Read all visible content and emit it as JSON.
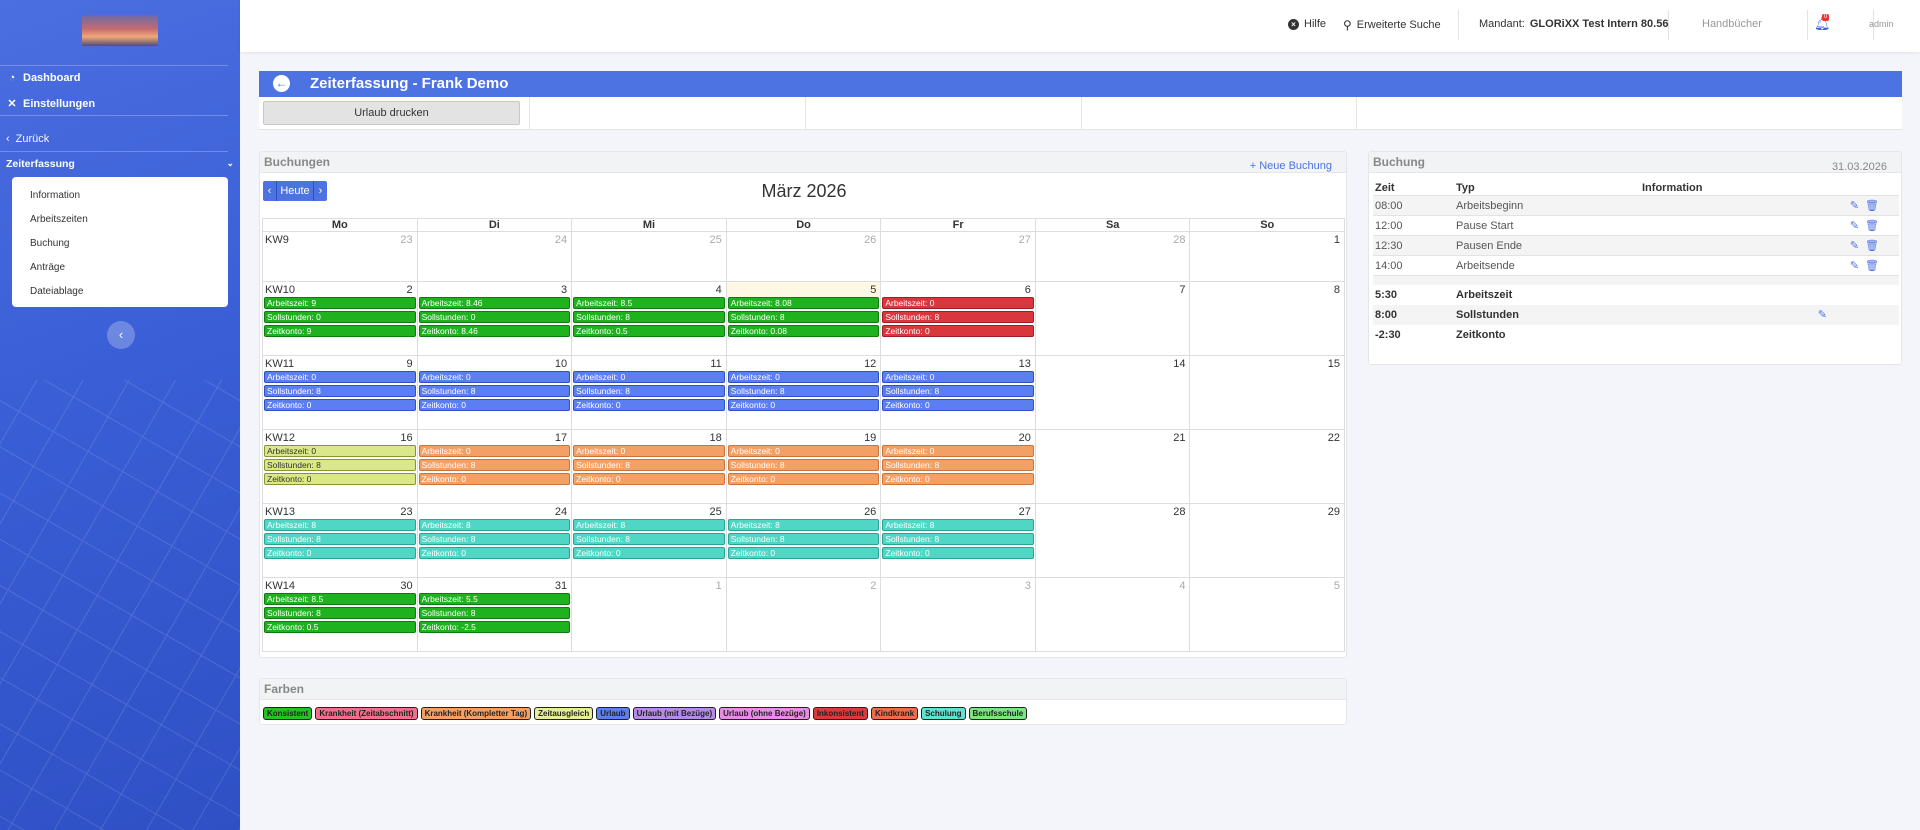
{
  "sidebar": {
    "dashboard": "Dashboard",
    "settings": "Einstellungen",
    "back": "Zurück",
    "section": "Zeiterfassung",
    "items": [
      "Information",
      "Arbeitszeiten",
      "Buchung",
      "Anträge",
      "Dateiablage"
    ]
  },
  "topbar": {
    "help": "Hilfe",
    "search": "Erweiterte Suche",
    "mandant_label": "Mandant:",
    "mandant_value": "GLORiXX Test Intern 80.56",
    "manuals": "Handbücher",
    "badge": "0",
    "user": "admin"
  },
  "header": {
    "title": "Zeiterfassung - Frank Demo",
    "print_button": "Urlaub drucken"
  },
  "calendar": {
    "panel_title": "Buchungen",
    "new_booking": "Neue Buchung",
    "today": "Heute",
    "month": "März 2026",
    "weekdays": [
      "Mo",
      "Di",
      "Mi",
      "Do",
      "Fr",
      "Sa",
      "So"
    ],
    "weeks": [
      {
        "kw": "KW9",
        "days": [
          {
            "n": "23",
            "o": 1
          },
          {
            "n": "24",
            "o": 1
          },
          {
            "n": "25",
            "o": 1
          },
          {
            "n": "26",
            "o": 1
          },
          {
            "n": "27",
            "o": 1
          },
          {
            "n": "28",
            "o": 1
          },
          {
            "n": "1"
          }
        ]
      },
      {
        "kw": "KW10",
        "days": [
          {
            "n": "2",
            "c": "green",
            "e": [
              "Arbeitszeit: 9",
              "Sollstunden: 0",
              "Zeitkonto: 9"
            ]
          },
          {
            "n": "3",
            "c": "green",
            "e": [
              "Arbeitszeit: 8.46",
              "Sollstunden: 0",
              "Zeitkonto: 8.46"
            ]
          },
          {
            "n": "4",
            "c": "green",
            "e": [
              "Arbeitszeit: 8.5",
              "Sollstunden: 8",
              "Zeitkonto: 0.5"
            ]
          },
          {
            "n": "5",
            "c": "green",
            "t": 1,
            "e": [
              "Arbeitszeit: 8.08",
              "Sollstunden: 8",
              "Zeitkonto: 0.08"
            ]
          },
          {
            "n": "6",
            "c": "red",
            "e": [
              "Arbeitszeit: 0",
              "Sollstunden: 8",
              "Zeitkonto: 0"
            ]
          },
          {
            "n": "7"
          },
          {
            "n": "8"
          }
        ]
      },
      {
        "kw": "KW11",
        "days": [
          {
            "n": "9",
            "c": "blue",
            "e": [
              "Arbeitszeit: 0",
              "Sollstunden: 8",
              "Zeitkonto: 0"
            ]
          },
          {
            "n": "10",
            "c": "blue",
            "e": [
              "Arbeitszeit: 0",
              "Sollstunden: 8",
              "Zeitkonto: 0"
            ]
          },
          {
            "n": "11",
            "c": "blue",
            "e": [
              "Arbeitszeit: 0",
              "Sollstunden: 8",
              "Zeitkonto: 0"
            ]
          },
          {
            "n": "12",
            "c": "blue",
            "e": [
              "Arbeitszeit: 0",
              "Sollstunden: 8",
              "Zeitkonto: 0"
            ]
          },
          {
            "n": "13",
            "c": "blue",
            "e": [
              "Arbeitszeit: 0",
              "Sollstunden: 8",
              "Zeitkonto: 0"
            ]
          },
          {
            "n": "14"
          },
          {
            "n": "15"
          }
        ]
      },
      {
        "kw": "KW12",
        "days": [
          {
            "n": "16",
            "c": "yellow",
            "e": [
              "Arbeitszeit: 0",
              "Sollstunden: 8",
              "Zeitkonto: 0"
            ]
          },
          {
            "n": "17",
            "c": "orange",
            "e": [
              "Arbeitszeit: 0",
              "Sollstunden: 8",
              "Zeitkonto: 0"
            ]
          },
          {
            "n": "18",
            "c": "orange",
            "e": [
              "Arbeitszeit: 0",
              "Sollstunden: 8",
              "Zeitkonto: 0"
            ]
          },
          {
            "n": "19",
            "c": "orange",
            "e": [
              "Arbeitszeit: 0",
              "Sollstunden: 8",
              "Zeitkonto: 0"
            ]
          },
          {
            "n": "20",
            "c": "orange",
            "e": [
              "Arbeitszeit: 0",
              "Sollstunden: 8",
              "Zeitkonto: 0"
            ]
          },
          {
            "n": "21"
          },
          {
            "n": "22"
          }
        ]
      },
      {
        "kw": "KW13",
        "days": [
          {
            "n": "23",
            "c": "teal",
            "e": [
              "Arbeitszeit: 8",
              "Sollstunden: 8",
              "Zeitkonto: 0"
            ]
          },
          {
            "n": "24",
            "c": "teal",
            "e": [
              "Arbeitszeit: 8",
              "Sollstunden: 8",
              "Zeitkonto: 0"
            ]
          },
          {
            "n": "25",
            "c": "teal",
            "e": [
              "Arbeitszeit: 8",
              "Sollstunden: 8",
              "Zeitkonto: 0"
            ]
          },
          {
            "n": "26",
            "c": "teal",
            "e": [
              "Arbeitszeit: 8",
              "Sollstunden: 8",
              "Zeitkonto: 0"
            ]
          },
          {
            "n": "27",
            "c": "teal",
            "e": [
              "Arbeitszeit: 8",
              "Sollstunden: 8",
              "Zeitkonto: 0"
            ]
          },
          {
            "n": "28"
          },
          {
            "n": "29"
          }
        ]
      },
      {
        "kw": "KW14",
        "days": [
          {
            "n": "30",
            "c": "green",
            "e": [
              "Arbeitszeit: 8.5",
              "Sollstunden: 8",
              "Zeitkonto: 0.5"
            ]
          },
          {
            "n": "31",
            "c": "green",
            "e": [
              "Arbeitszeit: 5.5",
              "Sollstunden: 8",
              "Zeitkonto: -2.5"
            ]
          },
          {
            "n": "1",
            "o": 1
          },
          {
            "n": "2",
            "o": 1
          },
          {
            "n": "3",
            "o": 1
          },
          {
            "n": "4",
            "o": 1
          },
          {
            "n": "5",
            "o": 1
          }
        ]
      }
    ]
  },
  "colors": {
    "green": {
      "bg": "#1fb21f",
      "border": "#0f7a0f",
      "text": "#ffffff"
    },
    "red": {
      "bg": "#d9363e",
      "border": "#a01e24",
      "text": "#ffffff"
    },
    "blue": {
      "bg": "#5b7ef0",
      "border": "#2f50c5",
      "text": "#ffffff"
    },
    "yellow": {
      "bg": "#dbe88a",
      "border": "#8a9433",
      "text": "#333333"
    },
    "orange": {
      "bg": "#f3a066",
      "border": "#c9743a",
      "text": "#ffffff"
    },
    "teal": {
      "bg": "#4fd6c4",
      "border": "#2aa595",
      "text": "#ffffff"
    }
  },
  "legend": {
    "title": "Farben",
    "items": [
      {
        "label": "Konsistent",
        "color": "#22c322"
      },
      {
        "label": "Krankheit (Zeitabschnitt)",
        "color": "#ef6f8c"
      },
      {
        "label": "Krankheit (Kompletter Tag)",
        "color": "#f3a066"
      },
      {
        "label": "Zeitausgleich",
        "color": "#e6ee9a"
      },
      {
        "label": "Urlaub",
        "color": "#5b7ef0"
      },
      {
        "label": "Urlaub (mit Bezüge)",
        "color": "#b58be8"
      },
      {
        "label": "Urlaub (ohne Bezüge)",
        "color": "#e98ce8"
      },
      {
        "label": "Inkonsistent",
        "color": "#dc3a3a"
      },
      {
        "label": "Kindkrank",
        "color": "#f06a4e"
      },
      {
        "label": "Schulung",
        "color": "#5fe3cf"
      },
      {
        "label": "Berufsschule",
        "color": "#7fe37f"
      }
    ]
  },
  "booking": {
    "title": "Buchung",
    "date": "31.03.2026",
    "headers": [
      "Zeit",
      "Typ",
      "Information"
    ],
    "rows": [
      {
        "time": "08:00",
        "type": "Arbeitsbeginn"
      },
      {
        "time": "12:00",
        "type": "Pause Start"
      },
      {
        "time": "12:30",
        "type": "Pausen Ende"
      },
      {
        "time": "14:00",
        "type": "Arbeitsende"
      }
    ],
    "summary": [
      {
        "value": "5:30",
        "label": "Arbeitszeit"
      },
      {
        "value": "8:00",
        "label": "Sollstunden"
      },
      {
        "value": "-2:30",
        "label": "Zeitkonto"
      }
    ]
  }
}
